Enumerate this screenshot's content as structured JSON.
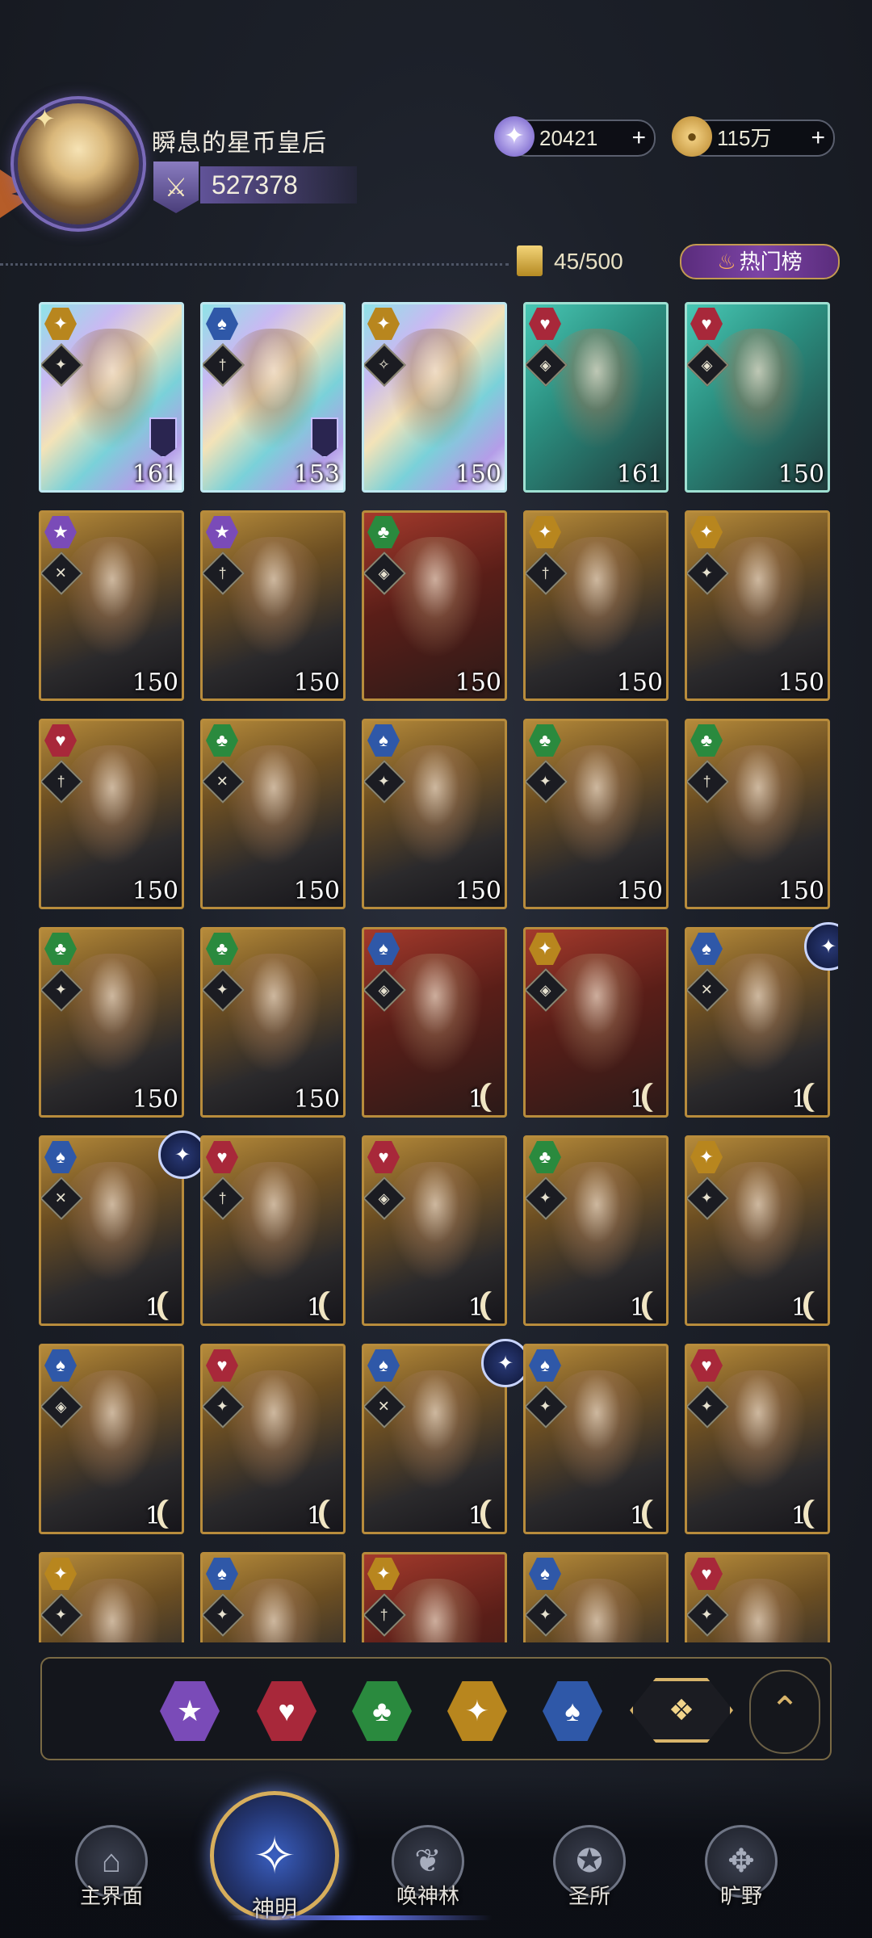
{
  "profile": {
    "name": "瞬息的星币皇后",
    "power": "527378"
  },
  "currencies": {
    "star_gems": "20421",
    "gold": "115万",
    "plus": "+"
  },
  "collection": {
    "capacity": "45/500",
    "hot_label": "热门榜"
  },
  "cards": [
    {
      "suit": "diamond",
      "role": "✦",
      "level": "161",
      "frame": "holo"
    },
    {
      "suit": "spade",
      "role": "†",
      "level": "153",
      "frame": "holo"
    },
    {
      "suit": "diamond",
      "role": "✧",
      "level": "150",
      "frame": "holo"
    },
    {
      "suit": "heart",
      "role": "◈",
      "level": "161",
      "frame": "teal"
    },
    {
      "suit": "heart",
      "role": "◈",
      "level": "150",
      "frame": "teal"
    },
    {
      "suit": "star",
      "role": "✕",
      "level": "150",
      "frame": "gold"
    },
    {
      "suit": "star",
      "role": "†",
      "level": "150",
      "frame": "gold"
    },
    {
      "suit": "club",
      "role": "◈",
      "level": "150",
      "frame": "red"
    },
    {
      "suit": "diamond",
      "role": "†",
      "level": "150",
      "frame": "gold"
    },
    {
      "suit": "diamond",
      "role": "✦",
      "level": "150",
      "frame": "gold"
    },
    {
      "suit": "heart",
      "role": "†",
      "level": "150",
      "frame": "gold"
    },
    {
      "suit": "club",
      "role": "✕",
      "level": "150",
      "frame": "gold"
    },
    {
      "suit": "spade",
      "role": "✦",
      "level": "150",
      "frame": "gold"
    },
    {
      "suit": "club",
      "role": "✦",
      "level": "150",
      "frame": "gold"
    },
    {
      "suit": "club",
      "role": "†",
      "level": "150",
      "frame": "gold"
    },
    {
      "suit": "club",
      "role": "✦",
      "level": "150",
      "frame": "gold"
    },
    {
      "suit": "club",
      "role": "✦",
      "level": "150",
      "frame": "gold"
    },
    {
      "suit": "spade",
      "role": "◈",
      "level": "1",
      "frame": "red"
    },
    {
      "suit": "diamond",
      "role": "◈",
      "level": "1",
      "frame": "red"
    },
    {
      "suit": "spade",
      "role": "✕",
      "level": "1",
      "frame": "gold",
      "badge": "✦"
    },
    {
      "suit": "spade",
      "role": "✕",
      "level": "1",
      "frame": "gold",
      "badge": "✦"
    },
    {
      "suit": "heart",
      "role": "†",
      "level": "1",
      "frame": "gold"
    },
    {
      "suit": "heart",
      "role": "◈",
      "level": "1",
      "frame": "gold"
    },
    {
      "suit": "club",
      "role": "✦",
      "level": "1",
      "frame": "gold"
    },
    {
      "suit": "diamond",
      "role": "✦",
      "level": "1",
      "frame": "gold"
    },
    {
      "suit": "spade",
      "role": "◈",
      "level": "1",
      "frame": "gold"
    },
    {
      "suit": "heart",
      "role": "✦",
      "level": "1",
      "frame": "gold"
    },
    {
      "suit": "spade",
      "role": "✕",
      "level": "1",
      "frame": "gold",
      "badge": "✦"
    },
    {
      "suit": "spade",
      "role": "✦",
      "level": "1",
      "frame": "gold"
    },
    {
      "suit": "heart",
      "role": "✦",
      "level": "1",
      "frame": "gold"
    },
    {
      "suit": "diamond",
      "role": "✦",
      "level": "",
      "frame": "gold"
    },
    {
      "suit": "spade",
      "role": "✦",
      "level": "",
      "frame": "gold"
    },
    {
      "suit": "diamond",
      "role": "†",
      "level": "",
      "frame": "red"
    },
    {
      "suit": "spade",
      "role": "✦",
      "level": "",
      "frame": "gold"
    },
    {
      "suit": "heart",
      "role": "✦",
      "level": "",
      "frame": "gold"
    }
  ],
  "filters": [
    {
      "name": "star",
      "glyph": "★"
    },
    {
      "name": "heart",
      "glyph": "♥"
    },
    {
      "name": "club",
      "glyph": "♣"
    },
    {
      "name": "diamond",
      "glyph": "✦"
    },
    {
      "name": "spade",
      "glyph": "♠"
    }
  ],
  "filter_all_glyph": "❖",
  "collapse_glyph": "⌃",
  "nav": [
    {
      "label": "主界面",
      "icon": "home-icon",
      "glyph": "⌂",
      "active": false
    },
    {
      "label": "神明",
      "icon": "book-icon",
      "glyph": "✧",
      "active": true
    },
    {
      "label": "唤神林",
      "icon": "tree-icon",
      "glyph": "❦",
      "active": false
    },
    {
      "label": "圣所",
      "icon": "sanctum-icon",
      "glyph": "✪",
      "active": false
    },
    {
      "label": "旷野",
      "icon": "compass-icon",
      "glyph": "✥",
      "active": false
    }
  ],
  "colors": {
    "accent_gold": "#d8b46a",
    "accent_purple": "#7c44a5",
    "background": "#1c2029"
  }
}
